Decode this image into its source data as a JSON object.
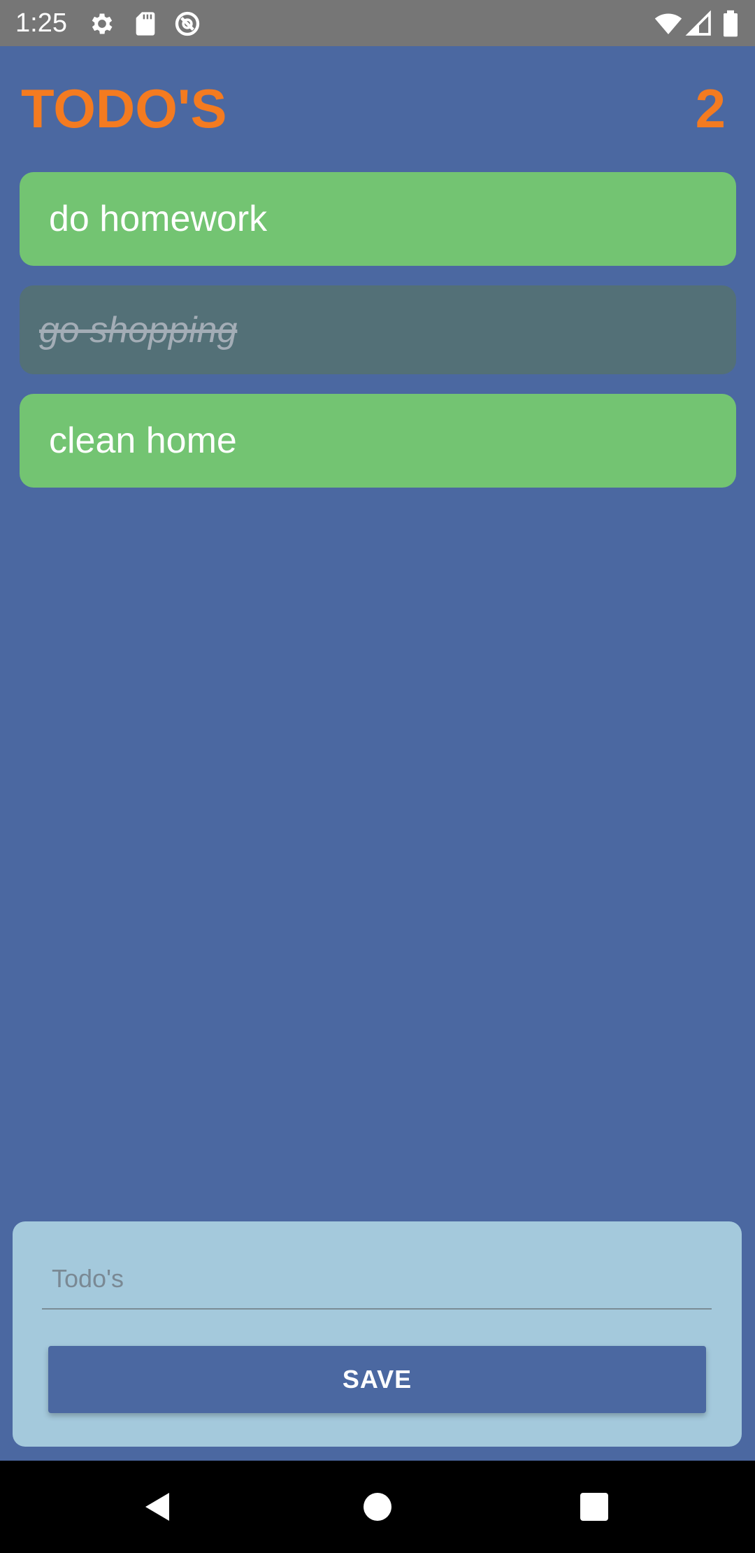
{
  "status_bar": {
    "time": "1:25",
    "icons": [
      "settings-icon",
      "sd-card-icon",
      "sync-icon",
      "wifi-icon",
      "signal-icon",
      "battery-icon"
    ]
  },
  "header": {
    "title": "TODO'S",
    "count": "2",
    "title_color": "#f47b20"
  },
  "todos": [
    {
      "text": "do homework",
      "done": false
    },
    {
      "text": "go shopping",
      "done": true
    },
    {
      "text": "clean home",
      "done": false
    }
  ],
  "input": {
    "placeholder": "Todo's",
    "value": ""
  },
  "save_button": {
    "label": "SAVE"
  },
  "colors": {
    "background": "#4b68a1",
    "active_item": "#73c472",
    "done_item": "#537077",
    "panel": "#a4c9dc"
  },
  "nav_bar": {
    "icons": [
      "back-icon",
      "home-icon",
      "recents-icon"
    ]
  }
}
